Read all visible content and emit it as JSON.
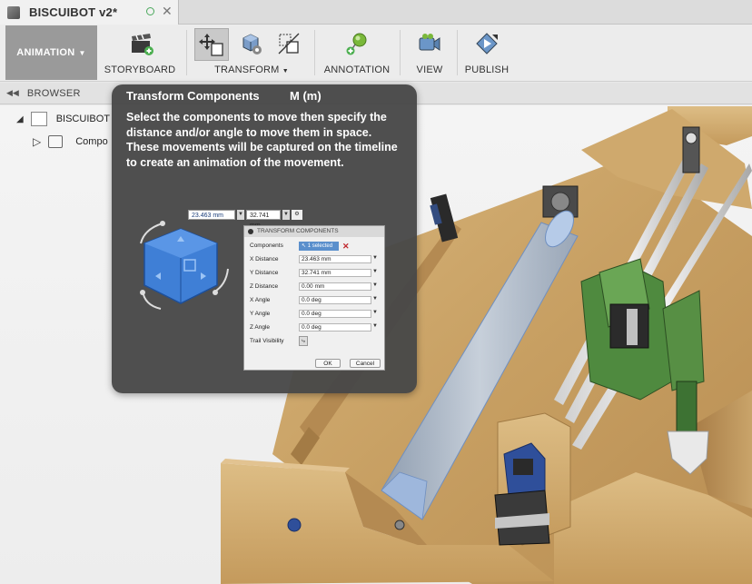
{
  "document": {
    "title": "BISCUIBOT v2*"
  },
  "toolbar": {
    "workspace": "ANIMATION",
    "groups": [
      {
        "label": "STORYBOARD"
      },
      {
        "label": "TRANSFORM"
      },
      {
        "label": "ANNOTATION"
      },
      {
        "label": "VIEW"
      },
      {
        "label": "PUBLISH"
      }
    ]
  },
  "browser": {
    "label": "BROWSER",
    "tree": [
      {
        "label": "BISCUIBOT"
      },
      {
        "label": "Compo"
      }
    ]
  },
  "tooltip": {
    "title": "Transform Components",
    "shortcut": "M (m)",
    "description": "Select the components to move then specify the distance and/or angle to move them in space. These movements will be captured on the timeline to create an animation of the movement.",
    "mini_fields": [
      "23.463 mm",
      "32.741 mm"
    ],
    "dialog": {
      "title": "TRANSFORM COMPONENTS",
      "rows": [
        {
          "label": "Components",
          "value": "1 selected"
        },
        {
          "label": "X Distance",
          "value": "23.463 mm"
        },
        {
          "label": "Y Distance",
          "value": "32.741 mm"
        },
        {
          "label": "Z Distance",
          "value": "0.00 mm"
        },
        {
          "label": "X Angle",
          "value": "0.0 deg"
        },
        {
          "label": "Y Angle",
          "value": "0.0 deg"
        },
        {
          "label": "Z Angle",
          "value": "0.0 deg"
        },
        {
          "label": "Trail Visibility",
          "value": ""
        }
      ],
      "ok": "OK",
      "cancel": "Cancel"
    }
  },
  "colors": {
    "wood": "#c9a46a",
    "selection": "#9cb8dc",
    "motor_bracket": "#4f8a3f"
  }
}
